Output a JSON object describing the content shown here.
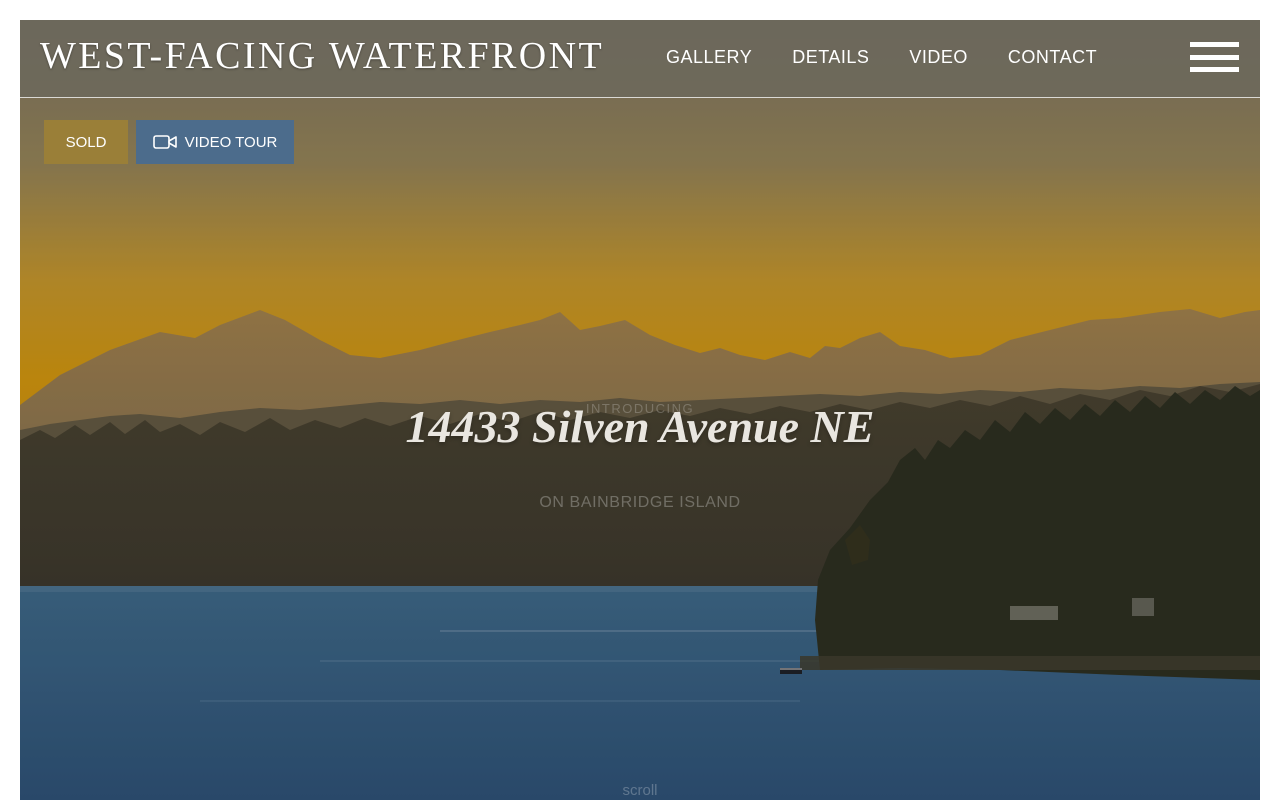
{
  "header": {
    "brand": "WEST-FACING WATERFRONT",
    "nav": [
      "GALLERY",
      "DETAILS",
      "VIDEO",
      "CONTACT"
    ],
    "menu_icon": "hamburger-menu-icon"
  },
  "badges": {
    "status": "SOLD",
    "video_tour": "VIDEO TOUR",
    "video_icon": "video-camera-icon"
  },
  "hero": {
    "eyebrow": "INTRODUCING",
    "address": "14433 Silven Avenue NE",
    "subtitle": "ON BAINBRIDGE ISLAND",
    "scroll": "scroll"
  },
  "colors": {
    "header_bg": "#6c685c",
    "sold_badge": "#9a7f38",
    "video_badge": "#4c6c8c",
    "sky_top": "#8a7f68",
    "sky_glow": "#d49e1c",
    "water": "#385f83"
  }
}
